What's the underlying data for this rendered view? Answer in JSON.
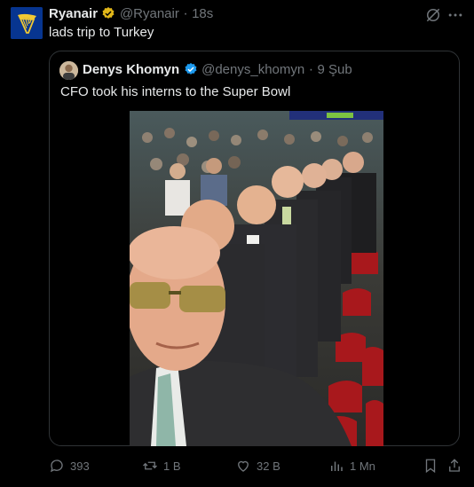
{
  "tweet": {
    "display_name": "Ryanair",
    "handle": "@Ryanair",
    "separator": "·",
    "time": "18s",
    "text": "lads trip to Turkey",
    "brand_color": "#073590",
    "logo_color": "#f1c933"
  },
  "quote": {
    "display_name": "Denys Khomyn",
    "handle": "@denys_khomyn",
    "separator": "·",
    "date": "9 Şub",
    "text": "CFO took his interns to the Super Bowl",
    "verified_color": "#1d9bf0"
  },
  "actions": {
    "replies": "393",
    "retweets": "1 B",
    "likes": "32 B",
    "views": "1 Mn"
  },
  "icons": [
    "grok-icon",
    "more-icon",
    "reply-icon",
    "retweet-icon",
    "like-icon",
    "views-icon",
    "bookmark-icon",
    "share-icon"
  ]
}
